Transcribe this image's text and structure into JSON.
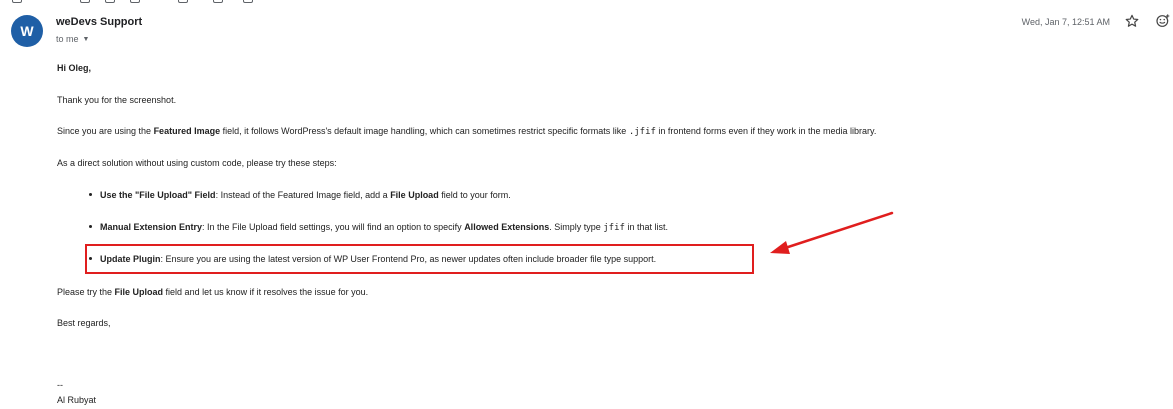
{
  "colors": {
    "avatar_bg": "#1f5fa6",
    "highlight": "#e01e1e"
  },
  "header": {
    "avatar_letter": "W",
    "sender": "weDevs Support",
    "recipient": "to me",
    "date": "Wed, Jan 7, 12:51 AM",
    "icons": [
      "star-icon",
      "emoji-react-icon",
      "chevron-down-icon"
    ]
  },
  "email": {
    "greeting": "Hi Oleg,",
    "thanks": "Thank you for the screenshot.",
    "para1": {
      "pre": "Since you are using the ",
      "bold": "Featured Image",
      "mid": " field, it follows WordPress's default image handling, which can sometimes restrict specific formats like ",
      "code": ".jfif",
      "post": " in frontend forms even if they work in the media library."
    },
    "para2": "As a direct solution without using custom code, please try these steps:",
    "steps": [
      {
        "title": "Use the \"File Upload\" Field",
        "text_pre": ": Instead of the Featured Image field, add a ",
        "bold": "File Upload",
        "text_post": " field to your form."
      },
      {
        "title": "Manual Extension Entry",
        "text_pre": ": In the File Upload field settings, you will find an option to specify ",
        "bold": "Allowed Extensions",
        "text_mid": ". Simply type ",
        "code": "jfif",
        "text_post": " in that list."
      },
      {
        "title": "Update Plugin",
        "text": ": Ensure you are using the latest version of WP User Frontend Pro, as newer updates often include broader file type support."
      }
    ],
    "closing_para": {
      "pre": "Please try the ",
      "bold": "File Upload",
      "post": " field and let us know if it resolves the issue for you."
    },
    "signoff": "Best regards,",
    "sig_dash": "--",
    "signature": "Al Rubyat"
  }
}
